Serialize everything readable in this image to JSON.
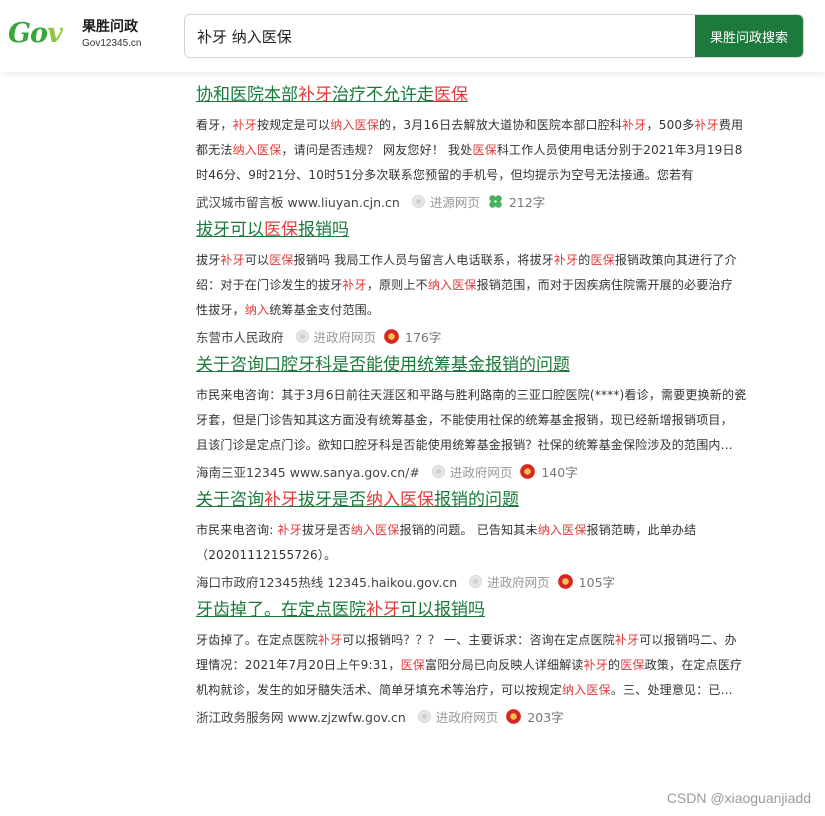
{
  "header": {
    "logo_mark": "Go",
    "logo_mark_v": "v",
    "logo_cn": "果胜问政",
    "logo_url": "Gov12345.cn",
    "search_value": "补牙 纳入医保",
    "search_button": "果胜问政搜索"
  },
  "results": [
    {
      "title_parts": [
        [
          "协和医院本部",
          0
        ],
        [
          "补牙",
          1
        ],
        [
          "治疗不允许走",
          0
        ],
        [
          "医保",
          1
        ]
      ],
      "snippet_lines": [
        [
          [
            "看牙，",
            0
          ],
          [
            "补牙",
            1
          ],
          [
            "按规定是可以",
            0
          ],
          [
            "纳入医保",
            1
          ],
          [
            "的，3月16日去解放大道协和医院本部口腔科",
            0
          ],
          [
            "补牙",
            1
          ],
          [
            "，500多",
            0
          ],
          [
            "补牙",
            1
          ],
          [
            "费用",
            0
          ]
        ],
        [
          [
            "都无法",
            0
          ],
          [
            "纳入医保",
            1
          ],
          [
            "，请问是否违规？ 网友您好！ 我处",
            0
          ],
          [
            "医保",
            1
          ],
          [
            "科工作人员使用电话分别于2021年3月19日8",
            0
          ]
        ],
        [
          [
            "时46分、9时21分、10时51分多次联系您预留的手机号，但均提示为空号无法接通。您若有",
            0
          ]
        ]
      ],
      "source": "武汉城市留言板 www.liuyan.cjn.cn",
      "enter": "进源网页",
      "badge": "clover",
      "count": "212字"
    },
    {
      "title_parts": [
        [
          "拔牙可以",
          0
        ],
        [
          "医保",
          1
        ],
        [
          "报销吗",
          0
        ]
      ],
      "snippet_lines": [
        [
          [
            "拔牙",
            0
          ],
          [
            "补牙",
            1
          ],
          [
            "可以",
            0
          ],
          [
            "医保",
            1
          ],
          [
            "报销吗 我局工作人员与留言人电话联系，将拔牙",
            0
          ],
          [
            "补牙",
            1
          ],
          [
            "的",
            0
          ],
          [
            "医保",
            1
          ],
          [
            "报销政策向其进行了介",
            0
          ]
        ],
        [
          [
            "绍：对于在门诊发生的拔牙",
            0
          ],
          [
            "补牙",
            1
          ],
          [
            "，原则上不",
            0
          ],
          [
            "纳入医保",
            1
          ],
          [
            "报销范围，而对于因疾病住院需开展的必要治疗",
            0
          ]
        ],
        [
          [
            "性拔牙，",
            0
          ],
          [
            "纳入",
            1
          ],
          [
            "统筹基金支付范围。",
            0
          ]
        ]
      ],
      "source": "东营市人民政府",
      "enter": "进政府网页",
      "badge": "emblem",
      "count": "176字"
    },
    {
      "title_parts": [
        [
          "关于咨询口腔牙科是否能使用统筹基金报销的问题",
          0
        ]
      ],
      "snippet_lines": [
        [
          [
            "市民来电咨询：其于3月6日前往天涯区和平路与胜利路南的三亚口腔医院(****)看诊，需要更换新的瓷",
            0
          ]
        ],
        [
          [
            "牙套，但是门诊告知其这方面没有统筹基金，不能使用社保的统筹基金报销，现已经新增报销项目，",
            0
          ]
        ],
        [
          [
            "且该门诊是定点门诊。欲知口腔牙科是否能使用统筹基金报销？社保的统筹基金保险涉及的范围内…",
            0
          ]
        ]
      ],
      "source": "海南三亚12345 www.sanya.gov.cn/#",
      "enter": "进政府网页",
      "badge": "emblem",
      "count": "140字"
    },
    {
      "title_parts": [
        [
          "关于咨询",
          0
        ],
        [
          "补牙",
          1
        ],
        [
          "拔牙是否",
          0
        ],
        [
          "纳入医保",
          1
        ],
        [
          "报销的问题",
          0
        ]
      ],
      "snippet_lines": [
        [
          [
            "市民来电咨询: ",
            0
          ],
          [
            "补牙",
            1
          ],
          [
            "拔牙是否",
            0
          ],
          [
            "纳入医保",
            1
          ],
          [
            "报销的问题。 已告知其未",
            0
          ],
          [
            "纳入医保",
            1
          ],
          [
            "报销范畴，此单办结",
            0
          ]
        ],
        [
          [
            "（20201112155726）。",
            0
          ]
        ]
      ],
      "source": "海口市政府12345热线 12345.haikou.gov.cn",
      "enter": "进政府网页",
      "badge": "emblem",
      "count": "105字"
    },
    {
      "title_parts": [
        [
          "牙齿掉了。在定点医院",
          0
        ],
        [
          "补牙",
          1
        ],
        [
          "可以报销吗",
          0
        ]
      ],
      "snippet_lines": [
        [
          [
            "牙齿掉了。在定点医院",
            0
          ],
          [
            "补牙",
            1
          ],
          [
            "可以报销吗？？？ 一、主要诉求：咨询在定点医院",
            0
          ],
          [
            "补牙",
            1
          ],
          [
            "可以报销吗二、办",
            0
          ]
        ],
        [
          [
            "理情况：2021年7月20日上午9:31，",
            0
          ],
          [
            "医保",
            1
          ],
          [
            "富阳分局已向反映人详细解读",
            0
          ],
          [
            "补牙",
            1
          ],
          [
            "的",
            0
          ],
          [
            "医保",
            1
          ],
          [
            "政策，在定点医疗",
            0
          ]
        ],
        [
          [
            "机构就诊，发生的如牙髓失活术、简单牙填充术等治疗，可以按规定",
            0
          ],
          [
            "纳入医保",
            1
          ],
          [
            "。三、处理意见：已…",
            0
          ]
        ]
      ],
      "source": "浙江政务服务网 www.zjzwfw.gov.cn",
      "enter": "进政府网页",
      "badge": "emblem",
      "count": "203字"
    }
  ],
  "watermark": "CSDN @xiaoguanjiadd"
}
